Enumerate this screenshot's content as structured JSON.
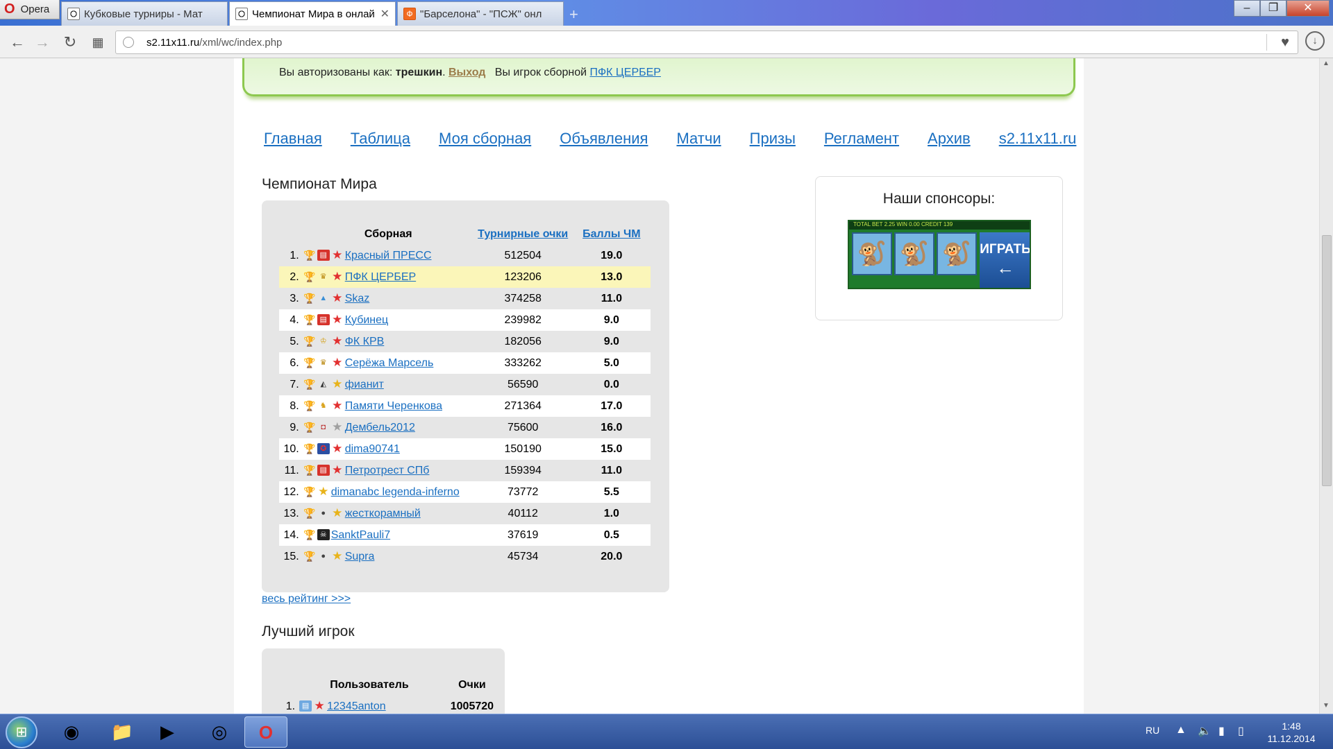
{
  "browser": {
    "menu_label": "Opera",
    "tabs": [
      {
        "label": "Кубковые турниры - Мат",
        "active": false
      },
      {
        "label": "Чемпионат Мира в онлай",
        "active": true
      },
      {
        "label": "\"Барселона\" - \"ПСЖ\" онл",
        "active": false
      }
    ],
    "new_tab_symbol": "+",
    "url_host": "s2.11x11.ru",
    "url_path": "/xml/wc/index.php"
  },
  "auth": {
    "prefix": "Вы авторизованы как:",
    "username": "трешкин",
    "logout": "Выход",
    "team_prefix": "Вы игрок сборной",
    "team": "ПФК ЦЕРБЕР"
  },
  "nav": [
    "Главная",
    "Таблица",
    "Моя сборная",
    "Объявления",
    "Матчи",
    "Призы",
    "Регламент",
    "Архив",
    "s2.11x11.ru"
  ],
  "championship": {
    "title": "Чемпионат Мира",
    "headers": {
      "team": "Сборная",
      "points": "Турнирные очки",
      "wc": "Баллы ЧМ"
    },
    "rows": [
      {
        "num": "1.",
        "team": "Красный ПРЕСС",
        "points": "512504",
        "wc": "19.0",
        "emblem": "flag-icon",
        "star": "red"
      },
      {
        "num": "2.",
        "team": "ПФК ЦЕРБЕР",
        "points": "123206",
        "wc": "13.0",
        "emblem": "crown-icon",
        "star": "red"
      },
      {
        "num": "3.",
        "team": "Skaz",
        "points": "374258",
        "wc": "11.0",
        "emblem": "drop-icon",
        "star": "red"
      },
      {
        "num": "4.",
        "team": "Кубинец",
        "points": "239982",
        "wc": "9.0",
        "emblem": "flag-icon",
        "star": "red"
      },
      {
        "num": "5.",
        "team": "ФК КРВ",
        "points": "182056",
        "wc": "9.0",
        "emblem": "cup-icon",
        "star": "red"
      },
      {
        "num": "6.",
        "team": "Серёжа Марсель",
        "points": "333262",
        "wc": "5.0",
        "emblem": "crown-icon",
        "star": "red"
      },
      {
        "num": "7.",
        "team": "фианит",
        "points": "56590",
        "wc": "0.0",
        "emblem": "triangle-icon",
        "star": "gold"
      },
      {
        "num": "8.",
        "team": "Памяти Черенкова",
        "points": "271364",
        "wc": "17.0",
        "emblem": "crest-icon",
        "star": "red"
      },
      {
        "num": "9.",
        "team": "Дембель2012",
        "points": "75600",
        "wc": "16.0",
        "emblem": "shield-icon",
        "star": "grey"
      },
      {
        "num": "10.",
        "team": "dima90741",
        "points": "150190",
        "wc": "15.0",
        "emblem": "star-emblem-icon",
        "star": "red"
      },
      {
        "num": "11.",
        "team": "Петротрест СПб",
        "points": "159394",
        "wc": "11.0",
        "emblem": "flag-icon",
        "star": "red"
      },
      {
        "num": "12.",
        "team": "dimanabc legenda-inferno",
        "points": "73772",
        "wc": "5.5",
        "emblem": "",
        "star": "gold"
      },
      {
        "num": "13.",
        "team": "жесткорамный",
        "points": "40112",
        "wc": "1.0",
        "emblem": "ball-icon",
        "star": "gold"
      },
      {
        "num": "14.",
        "team": "SanktPauli7",
        "points": "37619",
        "wc": "0.5",
        "emblem": "skull-icon",
        "star": ""
      },
      {
        "num": "15.",
        "team": "Supra",
        "points": "45734",
        "wc": "20.0",
        "emblem": "ball-icon",
        "star": "gold"
      }
    ],
    "all_rating_link": "весь рейтинг >>>"
  },
  "best_player": {
    "title": "Лучший игрок",
    "headers": {
      "user": "Пользователь",
      "points": "Очки"
    },
    "rows": [
      {
        "num": "1.",
        "user": "12345anton",
        "points": "1005720"
      }
    ]
  },
  "sponsors": {
    "title": "Наши спонсоры:",
    "ad_top": "TOTAL BET 2.25   WIN 0.00   CREDIT 139",
    "ad_button": "ИГРАТЬ"
  },
  "taskbar": {
    "lang": "RU",
    "time": "1:48",
    "date": "11.12.2014"
  },
  "colors": {
    "link": "#1a6fc1",
    "highlight_row": "#fbf6b9",
    "auth_border": "#8dc84f"
  }
}
